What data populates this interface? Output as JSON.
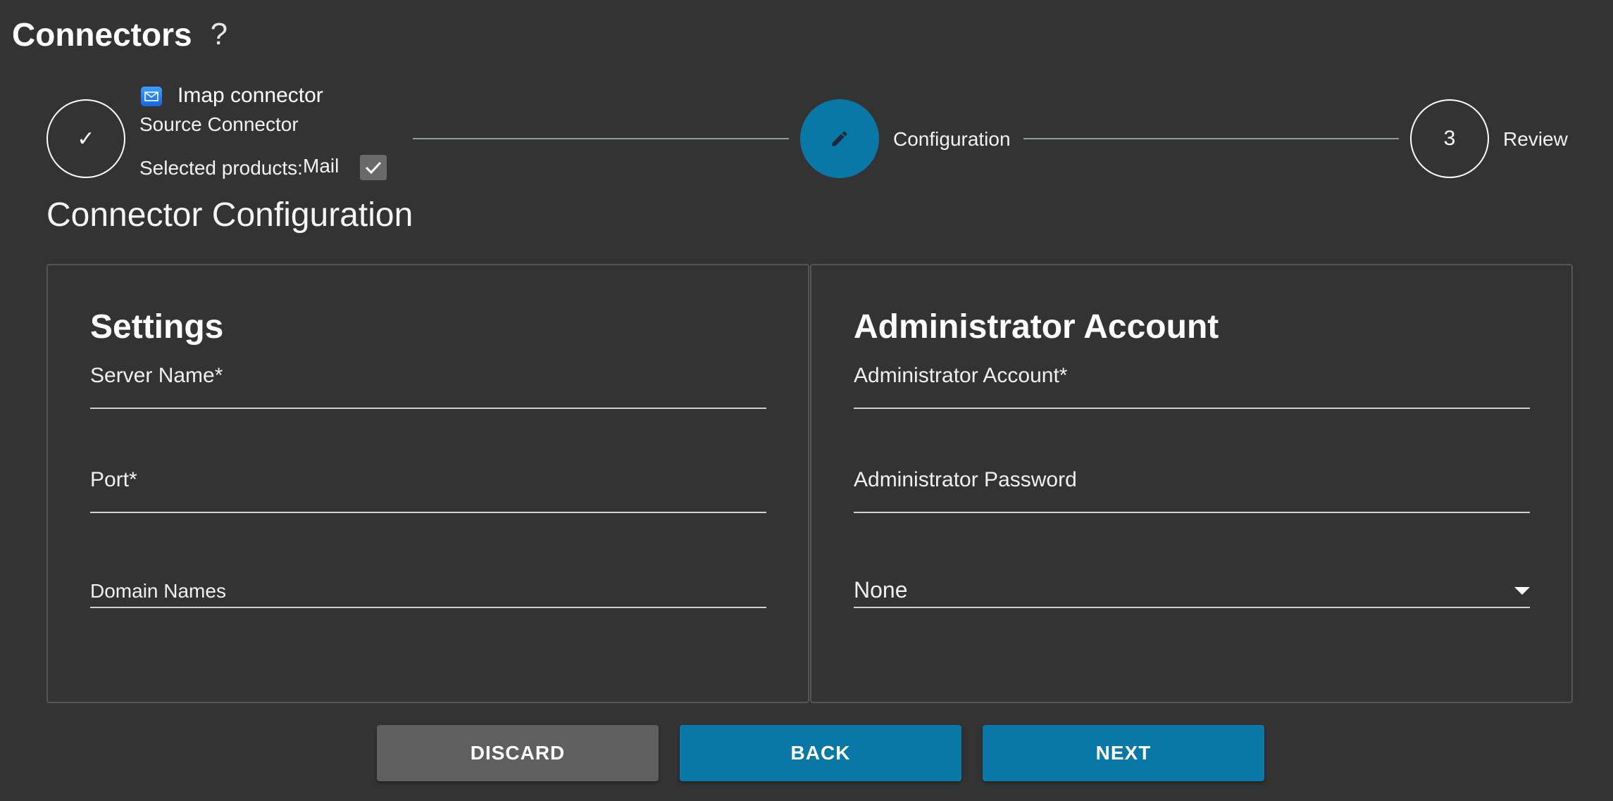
{
  "header": {
    "title": "Connectors",
    "help_glyph": "?"
  },
  "stepper": {
    "step1": {
      "connector_name": "Imap connector",
      "connector_type": "Source Connector",
      "selected_products_label": "Selected products:",
      "selected_products_value": "Mail",
      "checkmark": "✓"
    },
    "step2": {
      "label": "Configuration"
    },
    "step3": {
      "number": "3",
      "label": "Review"
    }
  },
  "section_heading": "Connector Configuration",
  "settings": {
    "title": "Settings",
    "server_name_label": "Server Name*",
    "port_label": "Port*",
    "domain_names_label": "Domain Names"
  },
  "admin": {
    "title": "Administrator Account",
    "account_label": "Administrator Account*",
    "password_label": "Administrator Password",
    "select_value": "None"
  },
  "buttons": {
    "discard": "DISCARD",
    "back": "BACK",
    "next": "NEXT"
  },
  "colors": {
    "accent": "#0a78a6",
    "background": "#333333",
    "discard": "#5f5f5f"
  }
}
